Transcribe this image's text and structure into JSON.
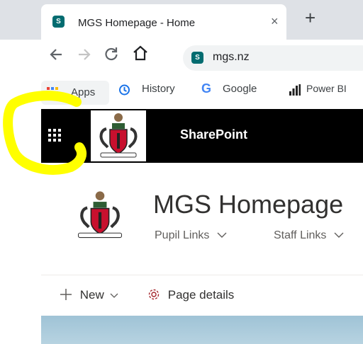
{
  "browser": {
    "tab_title": "MGS Homepage - Home",
    "tab_close": "×",
    "new_tab": "+",
    "favicon_letter": "S",
    "url": "mgs.nz",
    "bookmarks": [
      {
        "label": "Apps"
      },
      {
        "label": "History"
      },
      {
        "label": "Google"
      },
      {
        "label": "Power BI"
      }
    ]
  },
  "suitebar": {
    "brand": "SharePoint"
  },
  "site": {
    "title": "MGS Homepage",
    "nav": [
      {
        "label": "Pupil Links"
      },
      {
        "label": "Staff Links"
      }
    ]
  },
  "commands": {
    "new_label": "New",
    "page_details_label": "Page details"
  },
  "colors": {
    "suitebar_bg": "#000000",
    "sharepoint_teal": "#036c70",
    "annotation_yellow": "#ffff00"
  }
}
